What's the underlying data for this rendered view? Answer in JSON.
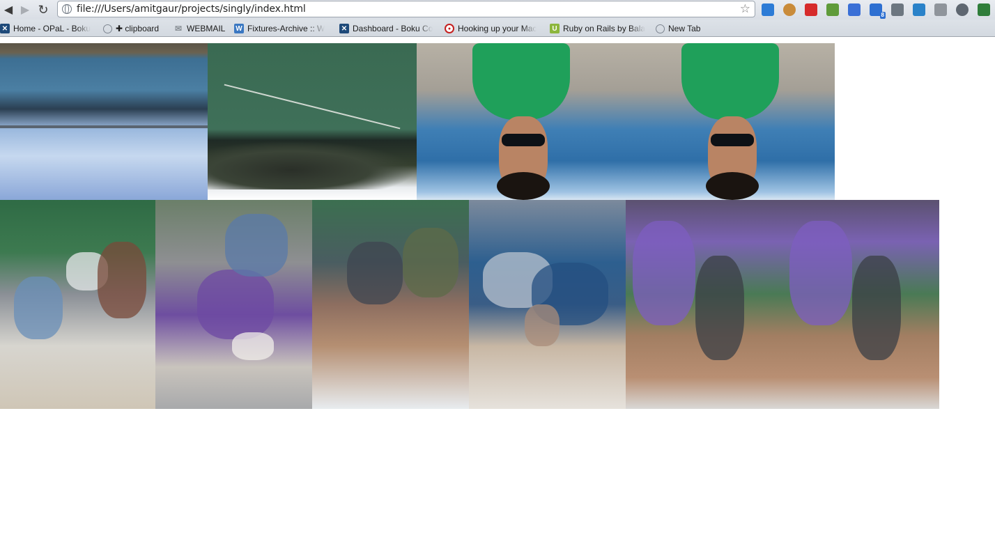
{
  "browser": {
    "url": "file:///Users/amitgaur/projects/singly/index.html",
    "nav": {
      "back": "◀",
      "forward": "▶",
      "reload": "↻"
    },
    "star_glyph": "☆"
  },
  "extensions": [
    {
      "icon": "screen-icon",
      "color": "#2c7bd6"
    },
    {
      "icon": "cookie-icon",
      "color": "#c98b3a"
    },
    {
      "icon": "red-ext-icon",
      "color": "#d62b2b"
    },
    {
      "icon": "evernote-icon",
      "color": "#5f9b3a"
    },
    {
      "icon": "rss-icon",
      "color": "#3a6fd6",
      "badge": ""
    },
    {
      "icon": "phone-icon",
      "color": "#2d6fd1",
      "badge": "8"
    },
    {
      "icon": "tools-icon",
      "color": "#6c7680"
    },
    {
      "icon": "mail-icon",
      "color": "#2a82c9"
    },
    {
      "icon": "k-icon",
      "color": "#8f949b"
    },
    {
      "icon": "camera-icon",
      "color": "#5e6670"
    },
    {
      "icon": "puzzle-icon",
      "color": "#2f7d3a"
    }
  ],
  "bookmarks": [
    {
      "label": "Home - OPaL - Boku",
      "fav": "✕",
      "color": "#1e4a7a"
    },
    {
      "label": "✚ clipboard",
      "fav": "",
      "color": "#7d8590"
    },
    {
      "label": "WEBMAIL",
      "fav": "✉",
      "color": "#b0b6bc"
    },
    {
      "label": "Fixtures-Archive :: W",
      "fav": "W",
      "color": "#3b78c2"
    },
    {
      "label": "Dashboard - Boku Co",
      "fav": "✕",
      "color": "#1e4a7a"
    },
    {
      "label": "Hooking up your Mac",
      "fav": "●",
      "color": "#c41e1e"
    },
    {
      "label": "Ruby on Rails by Bala",
      "fav": "U",
      "color": "#8cb63c"
    },
    {
      "label": "New Tab",
      "fav": "",
      "color": "#7d8590"
    }
  ],
  "photos": [
    {
      "name": "photo-waterfront"
    },
    {
      "name": "photo-tennis-court"
    },
    {
      "name": "photo-man-green-shirt"
    },
    {
      "name": "photo-man-green-shirt-2"
    },
    {
      "name": "photo-people-laptop"
    },
    {
      "name": "photo-man-hardhat"
    },
    {
      "name": "photo-street-plants"
    },
    {
      "name": "photo-man-laptop"
    },
    {
      "name": "photo-group-street"
    },
    {
      "name": "photo-group-street-2"
    }
  ]
}
